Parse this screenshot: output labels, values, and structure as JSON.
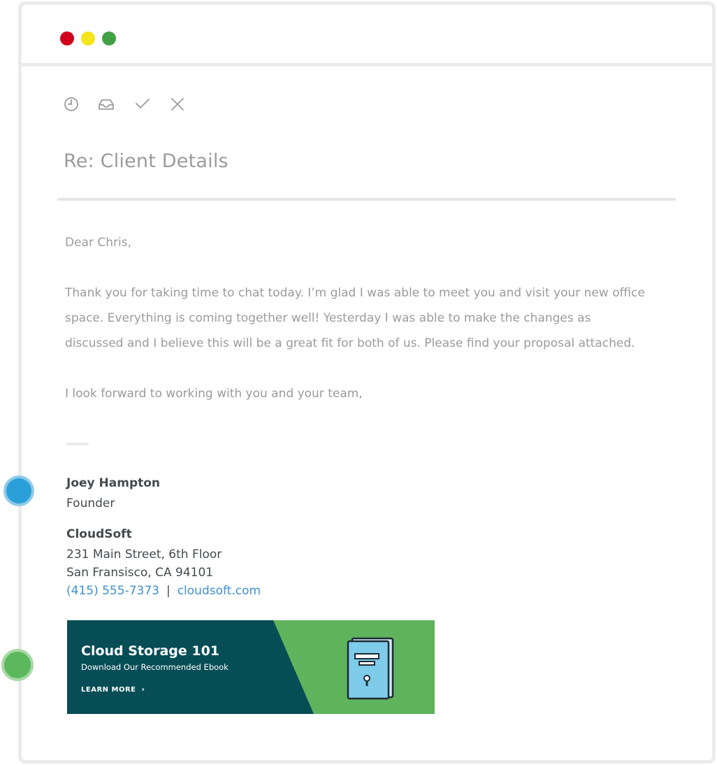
{
  "email": {
    "subject": "Re: Client Details",
    "greeting": "Dear Chris,",
    "paragraph": "Thank you for taking time to chat today. I’m glad I was able to meet you and visit your new office space. Everything is coming together well! Yesterday I was able to make the changes as discussed and I believe this will be a great fit for both of us.  Please find your proposal attached.",
    "closing": "I look forward to working with you and your team,"
  },
  "toolbar": {
    "icons": [
      "clock-icon",
      "inbox-icon",
      "check-icon",
      "close-icon"
    ]
  },
  "signature": {
    "name": "Joey Hampton",
    "title": "Founder",
    "company": "CloudSoft",
    "address_line1": "231 Main Street, 6th Floor",
    "address_line2": "San Fransisco,  CA  94101",
    "phone": "(415) 555-7373",
    "separator": "|",
    "website": "cloudsoft.com"
  },
  "banner": {
    "title": "Cloud Storage 101",
    "subtitle": "Download Our Recommended Ebook",
    "cta": "LEARN MORE",
    "cta_icon": "chevron-right-icon",
    "colors": {
      "dark": "#064d56",
      "light": "#5fb35d",
      "book": "#7ecbea"
    }
  },
  "window_controls": {
    "colors": {
      "close": "#d0021b",
      "minimize": "#f3e51b",
      "maximize": "#43a047"
    }
  },
  "markers": {
    "colors": {
      "signature": "#2b9fd8",
      "banner": "#5cb85c"
    }
  }
}
